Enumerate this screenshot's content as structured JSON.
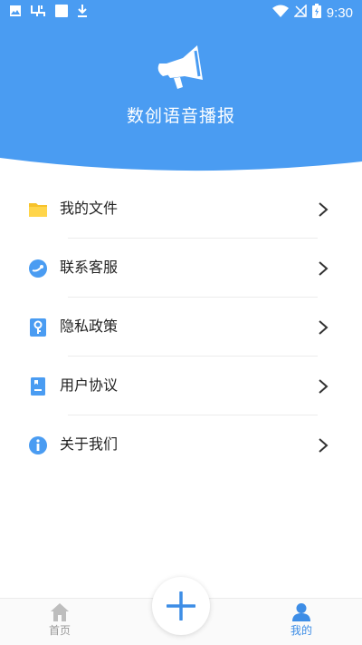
{
  "status_bar": {
    "time": "9:30",
    "left_icons": [
      "image-icon",
      "bug-icon",
      "square-icon",
      "download-icon"
    ],
    "right_icons": [
      "wifi-icon",
      "no-signal-icon",
      "battery-charging-icon"
    ]
  },
  "header": {
    "app_title": "数创语音播报",
    "logo": "megaphone-icon",
    "bg_color": "#4a9cf2"
  },
  "menu": {
    "items": [
      {
        "label": "我的文件",
        "icon": "folder-icon"
      },
      {
        "label": "联系客服",
        "icon": "customer-service-icon"
      },
      {
        "label": "隐私政策",
        "icon": "privacy-key-icon"
      },
      {
        "label": "用户协议",
        "icon": "agreement-document-icon"
      },
      {
        "label": "关于我们",
        "icon": "info-icon"
      }
    ]
  },
  "tabbar": {
    "home_label": "首页",
    "mine_label": "我的",
    "active_tab": "我的",
    "active_color": "#3d8de6"
  },
  "fab": {
    "icon": "plus-icon"
  }
}
